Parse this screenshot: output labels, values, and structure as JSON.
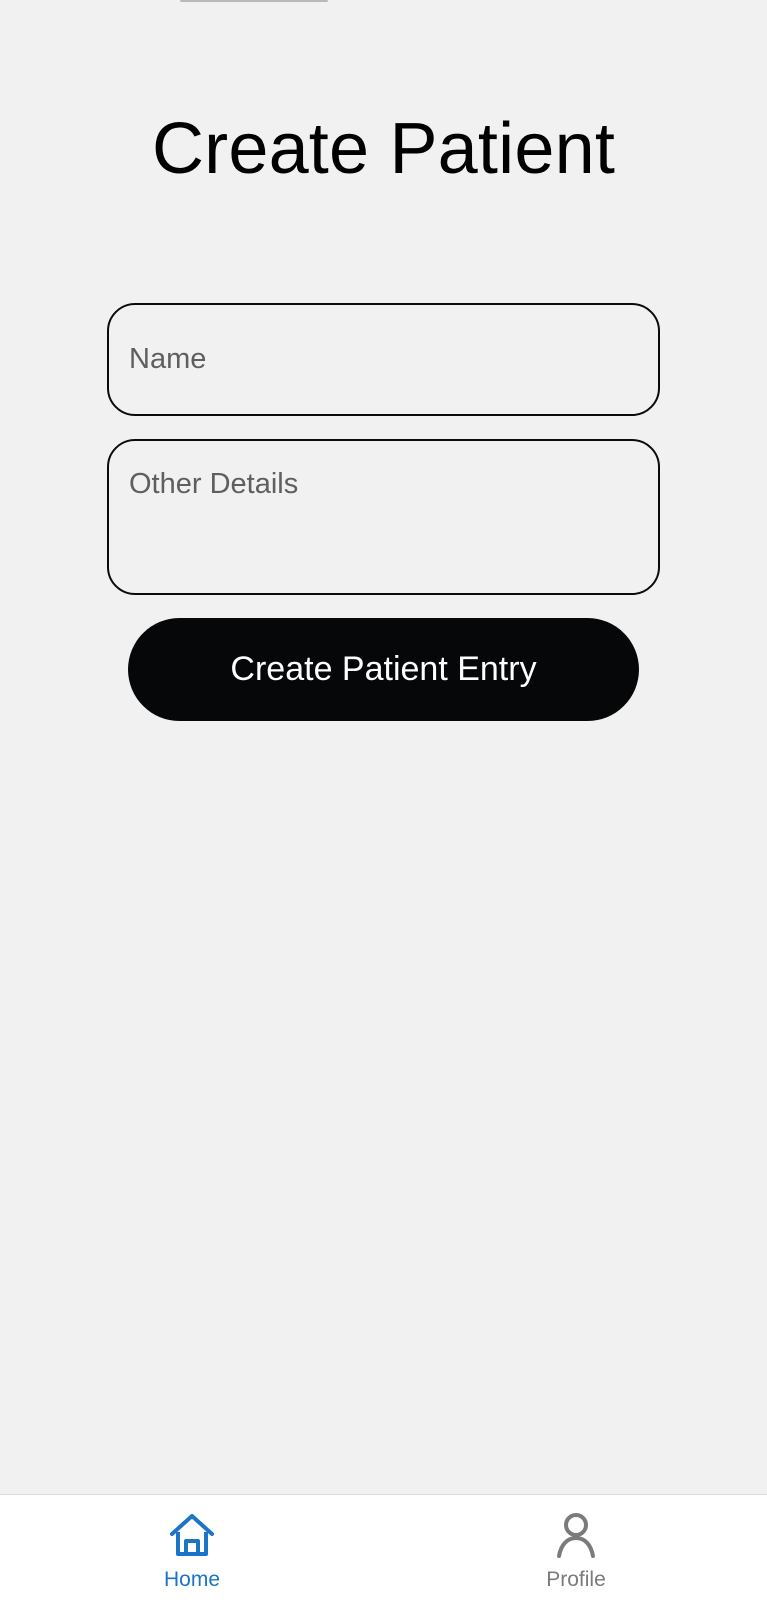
{
  "header": {
    "title": "Create Patient"
  },
  "form": {
    "name_placeholder": "Name",
    "name_value": "",
    "details_placeholder": "Other Details",
    "details_value": "",
    "submit_label": "Create Patient Entry"
  },
  "bottom_nav": {
    "items": [
      {
        "label": "Home",
        "icon": "home-icon",
        "active": true,
        "color": "#1b74c7"
      },
      {
        "label": "Profile",
        "icon": "person-icon",
        "active": false,
        "color": "#7b7b7b"
      }
    ]
  },
  "colors": {
    "background": "#f1f1f1",
    "button": "#050708",
    "accent": "#1b74c7"
  }
}
